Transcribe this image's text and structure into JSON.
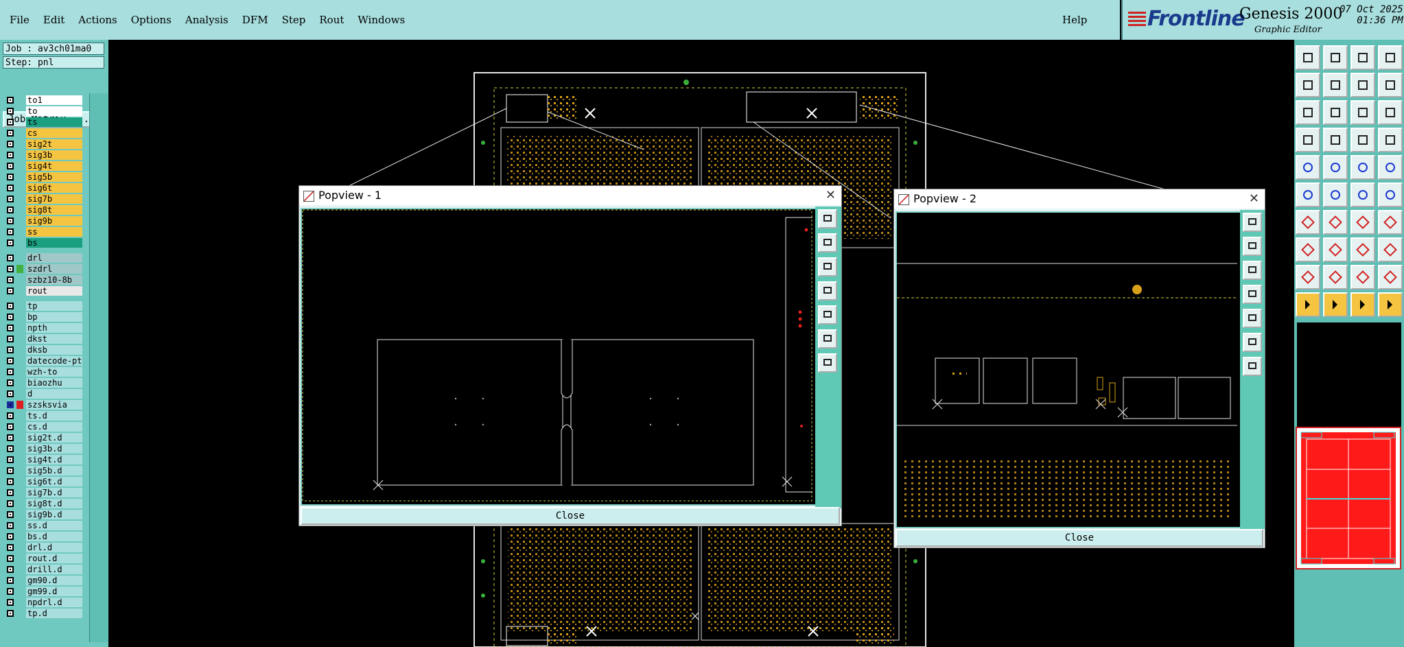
{
  "menu": {
    "items": [
      "File",
      "Edit",
      "Actions",
      "Options",
      "Analysis",
      "DFM",
      "Step",
      "Rout",
      "Windows"
    ],
    "help": "Help"
  },
  "brand": {
    "logo": "Frontline",
    "product": "Genesis 2000",
    "subtitle": "Graphic Editor",
    "date": "07 Oct 2025",
    "time": "01:36 PM"
  },
  "job": {
    "job_label": "Job : av3ch01ma0",
    "step_label": "Step: pnl",
    "matrix_button": "Job Matrix ..."
  },
  "layers": [
    {
      "name": "to1",
      "color": "#ffffff"
    },
    {
      "name": "to",
      "color": "#ffffff"
    },
    {
      "name": "ts",
      "color": "#1aa080"
    },
    {
      "name": "cs",
      "color": "#f5c542"
    },
    {
      "name": "sig2t",
      "color": "#f5c542"
    },
    {
      "name": "sig3b",
      "color": "#f5c542"
    },
    {
      "name": "sig4t",
      "color": "#f5c542"
    },
    {
      "name": "sig5b",
      "color": "#f5c542"
    },
    {
      "name": "sig6t",
      "color": "#f5c542"
    },
    {
      "name": "sig7b",
      "color": "#f5c542"
    },
    {
      "name": "sig8t",
      "color": "#f5c542"
    },
    {
      "name": "sig9b",
      "color": "#f5c542"
    },
    {
      "name": "ss",
      "color": "#f5c542"
    },
    {
      "name": "bs",
      "color": "#1aa080"
    },
    {
      "name": "drl",
      "color": "#a0c8c8",
      "gap": true
    },
    {
      "name": "szdrl",
      "color": "#a0c8c8",
      "swatch": "#40b040"
    },
    {
      "name": "szbz10-8b",
      "color": "#a0c8c8"
    },
    {
      "name": "rout",
      "color": "#e8e8e8"
    },
    {
      "name": "tp",
      "color": "#a8dede",
      "gap": true
    },
    {
      "name": "bp",
      "color": "#a8dede"
    },
    {
      "name": "npth",
      "color": "#a8dede"
    },
    {
      "name": "dkst",
      "color": "#a8dede"
    },
    {
      "name": "dksb",
      "color": "#a8dede"
    },
    {
      "name": "datecode-pt",
      "color": "#a8dede"
    },
    {
      "name": "wzh-to",
      "color": "#a8dede"
    },
    {
      "name": "biaozhu",
      "color": "#a8dede"
    },
    {
      "name": "d",
      "color": "#a8dede"
    },
    {
      "name": "szsksvia",
      "color": "#a8dede",
      "swatch": "#e02020",
      "active": true
    },
    {
      "name": "ts.d",
      "color": "#a8dede"
    },
    {
      "name": "cs.d",
      "color": "#a8dede"
    },
    {
      "name": "sig2t.d",
      "color": "#a8dede"
    },
    {
      "name": "sig3b.d",
      "color": "#a8dede"
    },
    {
      "name": "sig4t.d",
      "color": "#a8dede"
    },
    {
      "name": "sig5b.d",
      "color": "#a8dede"
    },
    {
      "name": "sig6t.d",
      "color": "#a8dede"
    },
    {
      "name": "sig7b.d",
      "color": "#a8dede"
    },
    {
      "name": "sig8t.d",
      "color": "#a8dede"
    },
    {
      "name": "sig9b.d",
      "color": "#a8dede"
    },
    {
      "name": "ss.d",
      "color": "#a8dede"
    },
    {
      "name": "bs.d",
      "color": "#a8dede"
    },
    {
      "name": "drl.d",
      "color": "#a8dede"
    },
    {
      "name": "rout.d",
      "color": "#a8dede"
    },
    {
      "name": "drill.d",
      "color": "#a8dede"
    },
    {
      "name": "gm90.d",
      "color": "#a8dede"
    },
    {
      "name": "gm99.d",
      "color": "#a8dede"
    },
    {
      "name": "npdrl.d",
      "color": "#a8dede"
    },
    {
      "name": "tp.d",
      "color": "#a8dede"
    }
  ],
  "popview1": {
    "title": "Popview - 1",
    "close": "Close"
  },
  "popview2": {
    "title": "Popview - 2",
    "close": "Close"
  },
  "close_glyph": "✕"
}
